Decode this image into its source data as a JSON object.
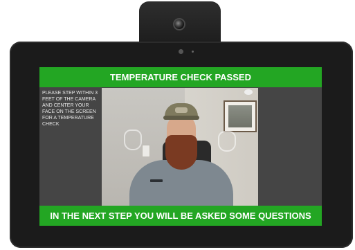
{
  "kiosk": {
    "header_banner": "TEMPERATURE CHECK PASSED",
    "instructions": "PLEASE STEP WITHIN 3 FEET OF THE CAMERA AND CENTER YOUR FACE ON THE SCREEN FOR A TEMPERATURE CHECK",
    "footer_banner": "IN THE NEXT STEP YOU WILL BE ASKED SOME QUESTIONS"
  },
  "colors": {
    "banner_green": "#23a623",
    "screen_gray": "#454545",
    "bezel": "#1b1b1b"
  }
}
